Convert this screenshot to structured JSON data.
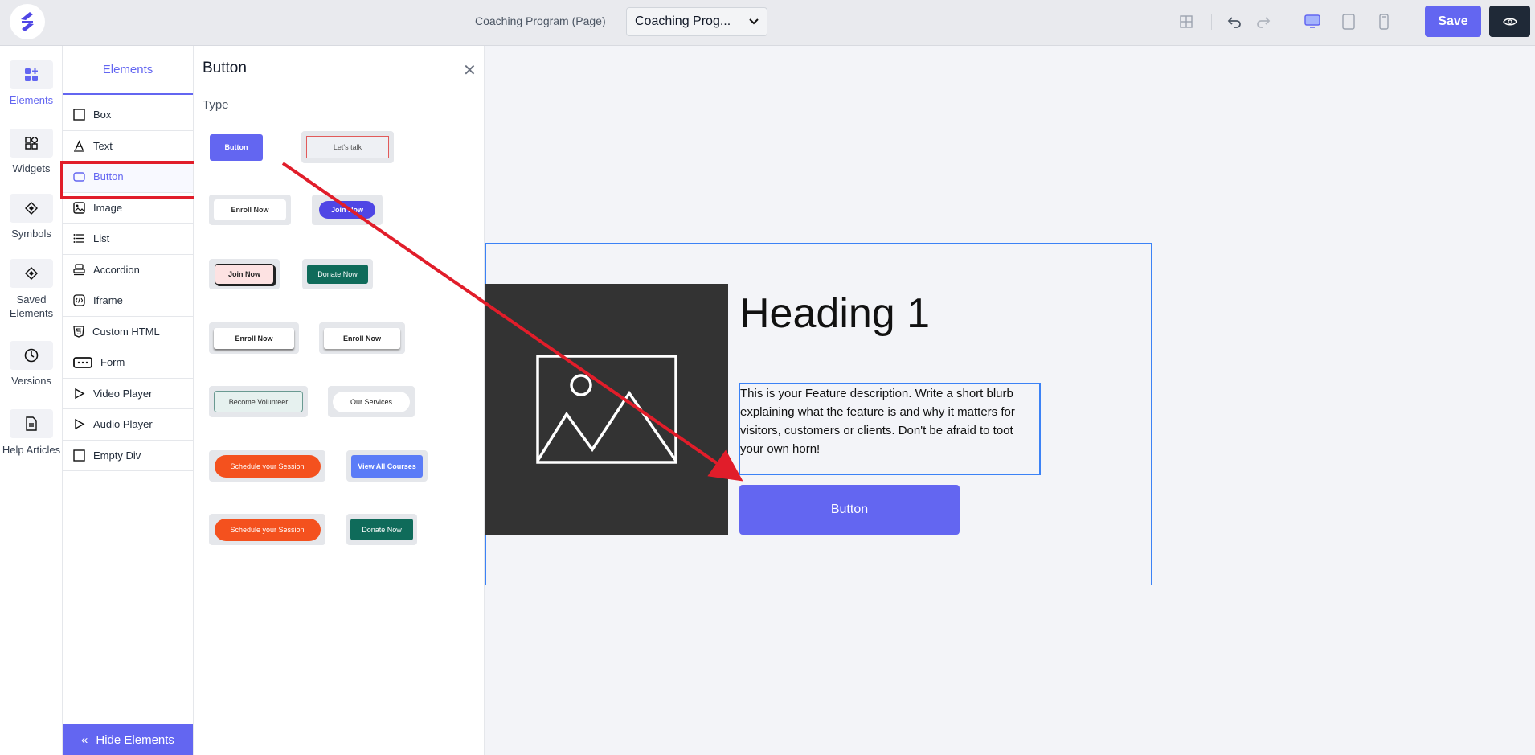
{
  "topbar": {
    "page_label": "Coaching Program (Page)",
    "page_select_value": "Coaching Prog...",
    "save_label": "Save"
  },
  "rail": {
    "items": [
      {
        "label": "Elements",
        "icon": "elements-icon"
      },
      {
        "label": "Widgets",
        "icon": "widgets-icon"
      },
      {
        "label": "Symbols",
        "icon": "symbols-icon"
      },
      {
        "label": "Saved Elements",
        "icon": "saved-elements-icon"
      },
      {
        "label": "Versions",
        "icon": "clock-icon"
      },
      {
        "label": "Help Articles",
        "icon": "document-icon"
      }
    ]
  },
  "elements_panel": {
    "tab_label": "Elements",
    "items": [
      {
        "label": "Box",
        "icon": "box-icon"
      },
      {
        "label": "Text",
        "icon": "text-icon"
      },
      {
        "label": "Button",
        "icon": "button-icon"
      },
      {
        "label": "Image",
        "icon": "image-icon"
      },
      {
        "label": "List",
        "icon": "list-icon"
      },
      {
        "label": "Accordion",
        "icon": "accordion-icon"
      },
      {
        "label": "Iframe",
        "icon": "iframe-icon"
      },
      {
        "label": "Custom HTML",
        "icon": "html-icon"
      },
      {
        "label": "Form",
        "icon": "form-icon"
      },
      {
        "label": "Video Player",
        "icon": "play-icon"
      },
      {
        "label": "Audio Player",
        "icon": "play-icon"
      },
      {
        "label": "Empty Div",
        "icon": "box-icon"
      }
    ],
    "hide_label": "Hide Elements"
  },
  "button_panel": {
    "title": "Button",
    "type_label": "Type",
    "samples": [
      "Button",
      "Let's talk",
      "Enroll Now",
      "Join Now",
      "Join Now",
      "Donate Now",
      "Enroll Now",
      "Enroll Now",
      "Become Volunteer",
      "Our Services",
      "Schedule your Session",
      "View All Courses",
      "Schedule your Session",
      "Donate Now"
    ]
  },
  "canvas": {
    "heading": "Heading 1",
    "description": "This is your Feature description. Write a short blurb explaining what the feature is and why it matters for visitors, customers or clients. Don't be afraid to toot your own horn!",
    "button_label": "Button"
  },
  "colors": {
    "accent": "#6366f1",
    "highlight_red": "#e11d2a",
    "selection_blue": "#3b82f6",
    "orange": "#f4511e",
    "teal": "#0f6b5a"
  }
}
